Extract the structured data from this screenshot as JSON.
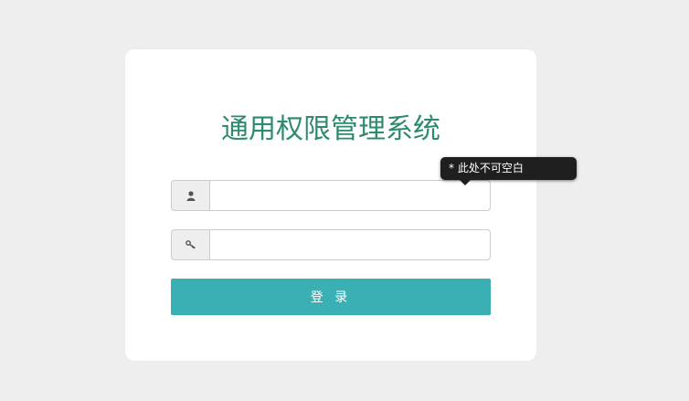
{
  "login": {
    "title": "通用权限管理系统",
    "username": {
      "value": "",
      "placeholder": "",
      "icon": "user-icon"
    },
    "password": {
      "value": "",
      "placeholder": "",
      "icon": "key-icon"
    },
    "submit_label": "登 录"
  },
  "validation": {
    "tooltip_text": "* 此处不可空白"
  },
  "colors": {
    "background": "#eeeeee",
    "title": "#2e8a6e",
    "button": "#3aafb4",
    "tooltip": "#1f1f1f"
  }
}
